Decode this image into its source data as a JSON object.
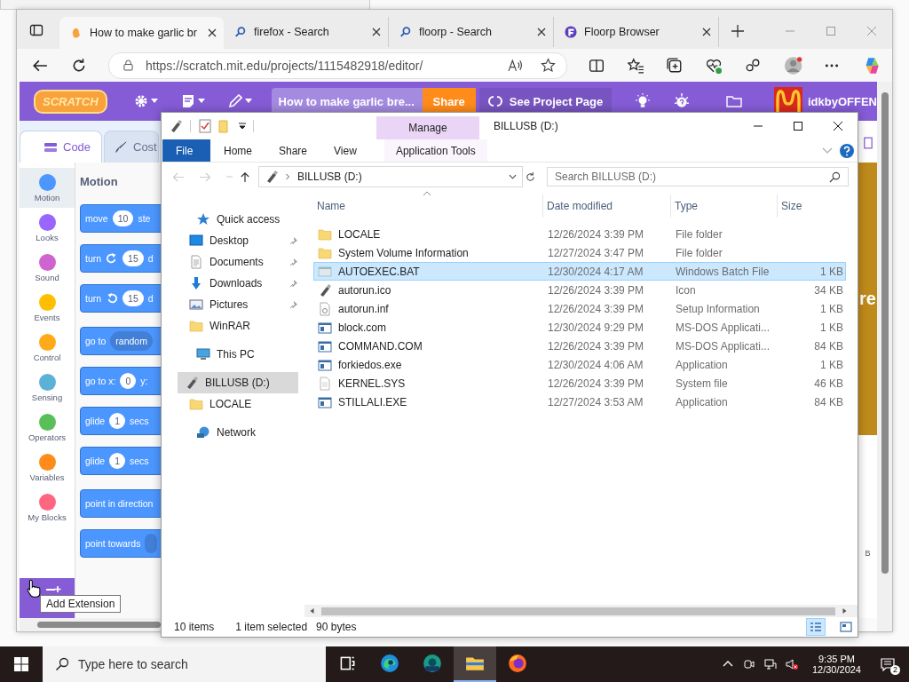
{
  "browser": {
    "tabs": [
      {
        "title": "How to make garlic br",
        "kind": "scratch",
        "selected": true
      },
      {
        "title": "firefox - Search",
        "kind": "search",
        "selected": false
      },
      {
        "title": "floorp - Search",
        "kind": "search",
        "selected": false
      },
      {
        "title": "Floorp Browser",
        "kind": "floorp",
        "selected": false
      }
    ],
    "url": "https://scratch.mit.edu/projects/1115482918/editor/"
  },
  "scratch": {
    "logo": "SCRATCH",
    "project_title": "How to make garlic bre...",
    "share_button": "Share",
    "project_page_button": "See Project Page",
    "username": "idkbyOFFEN",
    "editor_tabs": [
      {
        "label": "Code",
        "kind": "code",
        "selected": true
      },
      {
        "label": "Cost",
        "kind": "costumes",
        "selected": false
      }
    ],
    "categories": [
      {
        "label": "Motion",
        "color": "#4c97ff",
        "selected": true
      },
      {
        "label": "Looks",
        "color": "#9966ff",
        "selected": false
      },
      {
        "label": "Sound",
        "color": "#cf63cf",
        "selected": false
      },
      {
        "label": "Events",
        "color": "#ffbf00",
        "selected": false
      },
      {
        "label": "Control",
        "color": "#ffab19",
        "selected": false
      },
      {
        "label": "Sensing",
        "color": "#5cb1d6",
        "selected": false
      },
      {
        "label": "Operators",
        "color": "#59c059",
        "selected": false
      },
      {
        "label": "Variables",
        "color": "#ff8c1a",
        "selected": false
      },
      {
        "label": "My Blocks",
        "color": "#ff6680",
        "selected": false
      }
    ],
    "palette_heading": "Motion",
    "block_groups": [
      [
        {
          "parts": [
            {
              "kind": "text",
              "text": "move"
            },
            {
              "kind": "input",
              "text": "10"
            },
            {
              "kind": "text",
              "text": "ste"
            }
          ]
        },
        {
          "parts": [
            {
              "kind": "text",
              "text": "turn"
            },
            {
              "kind": "cw"
            },
            {
              "kind": "input",
              "text": "15"
            },
            {
              "kind": "text",
              "text": "d"
            }
          ]
        },
        {
          "parts": [
            {
              "kind": "text",
              "text": "turn"
            },
            {
              "kind": "ccw"
            },
            {
              "kind": "input",
              "text": "15"
            },
            {
              "kind": "text",
              "text": "d"
            }
          ]
        }
      ],
      [
        {
          "parts": [
            {
              "kind": "text",
              "text": "go to"
            },
            {
              "kind": "dropdown",
              "text": "random"
            }
          ]
        },
        {
          "parts": [
            {
              "kind": "text",
              "text": "go to x:"
            },
            {
              "kind": "input",
              "text": "0"
            },
            {
              "kind": "text",
              "text": "y:"
            }
          ]
        },
        {
          "parts": [
            {
              "kind": "text",
              "text": "glide"
            },
            {
              "kind": "input",
              "text": "1"
            },
            {
              "kind": "text",
              "text": "secs"
            }
          ]
        },
        {
          "parts": [
            {
              "kind": "text",
              "text": "glide"
            },
            {
              "kind": "input",
              "text": "1"
            },
            {
              "kind": "text",
              "text": "secs"
            }
          ]
        }
      ],
      [
        {
          "parts": [
            {
              "kind": "text",
              "text": "point in direction"
            }
          ]
        },
        {
          "parts": [
            {
              "kind": "text",
              "text": "point towards"
            },
            {
              "kind": "dropdown"
            }
          ]
        }
      ]
    ],
    "extension_tooltip": "Add Extension",
    "stage_text": "re",
    "corner_text": "B"
  },
  "explorer": {
    "title": "BILLUSB (D:)",
    "context_tab": "Manage",
    "ribbon_tabs": [
      {
        "label": "File",
        "kind": "file"
      },
      {
        "label": "Home",
        "kind": "plain"
      },
      {
        "label": "Share",
        "kind": "plain"
      },
      {
        "label": "View",
        "kind": "plain"
      },
      {
        "label": "Application Tools",
        "kind": "context"
      }
    ],
    "address": "BILLUSB (D:)",
    "search_placeholder": "Search BILLUSB (D:)",
    "nav": [
      {
        "label": "Quick access",
        "kind": "star",
        "selected": false,
        "children": [
          {
            "label": "Desktop",
            "kind": "desktop",
            "pinned": true,
            "selected": false
          },
          {
            "label": "Documents",
            "kind": "document",
            "pinned": true,
            "selected": false
          },
          {
            "label": "Downloads",
            "kind": "download",
            "pinned": true,
            "selected": false
          },
          {
            "label": "Pictures",
            "kind": "pictures",
            "pinned": true,
            "selected": false
          },
          {
            "label": "WinRAR",
            "kind": "folder",
            "pinned": false,
            "selected": false
          }
        ]
      },
      {
        "label": "This PC",
        "kind": "pc",
        "selected": false
      },
      {
        "label": "BILLUSB (D:)",
        "kind": "drive",
        "selected": true,
        "children": [
          {
            "label": "LOCALE",
            "kind": "folder",
            "selected": false
          }
        ]
      },
      {
        "label": "Network",
        "kind": "network",
        "selected": false
      }
    ],
    "columns": [
      "Name",
      "Date modified",
      "Type",
      "Size"
    ],
    "files": [
      {
        "name": "LOCALE",
        "modified": "12/26/2024 3:39 PM",
        "type": "File folder",
        "kind": "folder",
        "selected": false
      },
      {
        "name": "System Volume Information",
        "modified": "12/27/2024 3:47 PM",
        "type": "File folder",
        "kind": "folder",
        "selected": false
      },
      {
        "name": "AUTOEXEC.BAT",
        "modified": "12/30/2024 4:17 AM",
        "type": "Windows Batch File",
        "size": "1 KB",
        "kind": "batch",
        "selected": true
      },
      {
        "name": "autorun.ico",
        "modified": "12/26/2024 3:39 PM",
        "type": "Icon",
        "size": "34 KB",
        "kind": "drive",
        "selected": false
      },
      {
        "name": "autorun.inf",
        "modified": "12/26/2024 3:39 PM",
        "type": "Setup Information",
        "size": "1 KB",
        "kind": "inf",
        "selected": false
      },
      {
        "name": "block.com",
        "modified": "12/30/2024 9:29 PM",
        "type": "MS-DOS Applicati...",
        "size": "1 KB",
        "kind": "app",
        "selected": false
      },
      {
        "name": "COMMAND.COM",
        "modified": "12/26/2024 3:39 PM",
        "type": "MS-DOS Applicati...",
        "size": "84 KB",
        "kind": "app",
        "selected": false
      },
      {
        "name": "forkiedos.exe",
        "modified": "12/30/2024 4:06 AM",
        "type": "Application",
        "size": "1 KB",
        "kind": "app",
        "selected": false
      },
      {
        "name": "KERNEL.SYS",
        "modified": "12/26/2024 3:39 PM",
        "type": "System file",
        "size": "46 KB",
        "kind": "sys",
        "selected": false
      },
      {
        "name": "STILLALI.EXE",
        "modified": "12/27/2024 3:53 AM",
        "type": "Application",
        "size": "84 KB",
        "kind": "app",
        "selected": false
      }
    ],
    "status": {
      "count": "10 items",
      "selection": "1 item selected",
      "size": "90 bytes"
    },
    "views": [
      {
        "kind": "details",
        "selected": true
      },
      {
        "kind": "tiles",
        "selected": false
      }
    ]
  },
  "taskbar": {
    "search_placeholder": "Type here to search",
    "apps": [
      {
        "kind": "taskview",
        "selected": false
      },
      {
        "kind": "edge",
        "selected": false
      },
      {
        "kind": "edge_beta",
        "selected": false
      },
      {
        "kind": "explorer",
        "selected": true
      },
      {
        "kind": "firefox",
        "selected": false
      }
    ],
    "time": "9:35 PM",
    "date": "12/30/2024",
    "notifications": "2"
  }
}
